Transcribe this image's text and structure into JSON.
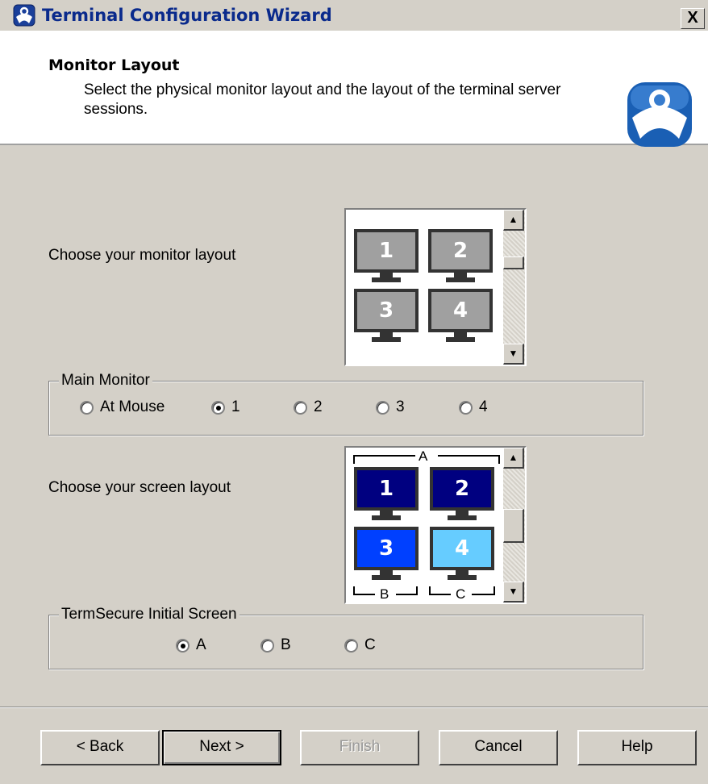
{
  "window": {
    "title": "Terminal Configuration Wizard",
    "close_glyph": "X"
  },
  "header": {
    "title": "Monitor Layout",
    "subtitle": "Select the physical monitor layout and the layout of the terminal server sessions."
  },
  "monitor_layout": {
    "label": "Choose your monitor layout",
    "monitors": [
      "1",
      "2",
      "3",
      "4"
    ]
  },
  "main_monitor": {
    "legend": "Main Monitor",
    "options": [
      {
        "label": "At Mouse",
        "checked": false
      },
      {
        "label": "1",
        "checked": true
      },
      {
        "label": "2",
        "checked": false
      },
      {
        "label": "3",
        "checked": false
      },
      {
        "label": "4",
        "checked": false
      }
    ]
  },
  "screen_layout": {
    "label": "Choose your screen layout",
    "screens": [
      {
        "label": "1",
        "color": "#000080"
      },
      {
        "label": "2",
        "color": "#000080"
      },
      {
        "label": "3",
        "color": "#0040ff"
      },
      {
        "label": "4",
        "color": "#66ccff"
      }
    ],
    "bracket_top": "A",
    "bracket_left": "B",
    "bracket_right": "C"
  },
  "termsecure": {
    "legend": "TermSecure Initial Screen",
    "options": [
      {
        "label": "A",
        "checked": true
      },
      {
        "label": "B",
        "checked": false
      },
      {
        "label": "C",
        "checked": false
      }
    ]
  },
  "buttons": {
    "back": "< Back",
    "next": "Next >",
    "finish": "Finish",
    "cancel": "Cancel",
    "help": "Help"
  },
  "colors": {
    "monitor_gray": "#a0a0a0",
    "title_text": "#0a2a8c",
    "dialog_bg": "#d4d0c8"
  }
}
